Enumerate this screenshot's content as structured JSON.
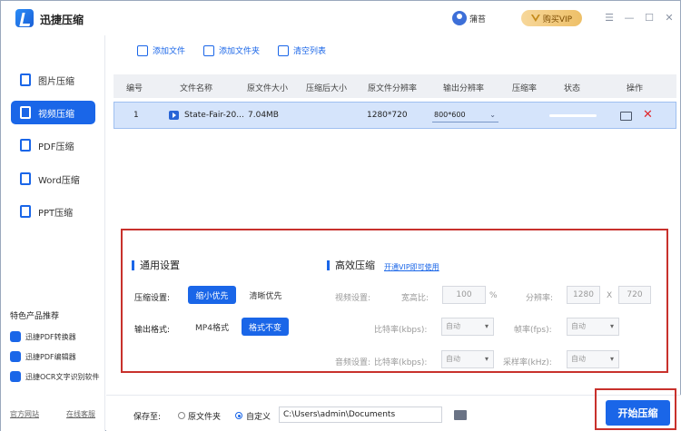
{
  "app": {
    "title": "迅捷压缩",
    "user": "蒲苔",
    "vip_label": "购买VIP"
  },
  "sidebar": {
    "items": [
      {
        "label": "图片压缩",
        "icon": "image-icon"
      },
      {
        "label": "视频压缩",
        "icon": "video-icon",
        "active": true
      },
      {
        "label": "PDF压缩",
        "icon": "pdf-icon"
      },
      {
        "label": "Word压缩",
        "icon": "word-icon"
      },
      {
        "label": "PPT压缩",
        "icon": "ppt-icon"
      }
    ],
    "promo_title": "特色产品推荐",
    "promo": [
      "迅捷PDF转换器",
      "迅捷PDF编辑器",
      "迅捷OCR文字识别软件"
    ],
    "footer_left": "官方网站",
    "footer_right": "在线客服"
  },
  "toolbar": {
    "add_file": "添加文件",
    "add_folder": "添加文件夹",
    "clear_list": "清空列表"
  },
  "table": {
    "headers": [
      "编号",
      "文件名称",
      "原文件大小",
      "压缩后大小",
      "原文件分辨率",
      "输出分辨率",
      "压缩率",
      "状态",
      "操作"
    ],
    "rows": [
      {
        "index": "1",
        "name": "State-Fair-20...",
        "size": "7.04MB",
        "compressed": "",
        "resolution": "1280*720",
        "output_res": "800*600",
        "ratio": "",
        "status_progress": 0
      }
    ]
  },
  "general": {
    "title": "通用设置",
    "compress_label": "压缩设置:",
    "compress_options": [
      "缩小优先",
      "清晰优先"
    ],
    "output_label": "输出格式:",
    "output_format": "MP4格式",
    "keep_format": "格式不变"
  },
  "efficient": {
    "title": "高效压缩",
    "vip_link": "开通VIP即可使用",
    "video_label": "视频设置:",
    "aspect_label": "宽高比:",
    "aspect_value": "100",
    "aspect_unit": "%",
    "resolution_label": "分辨率:",
    "res_w": "1280",
    "res_x": "X",
    "res_h": "720",
    "bitrate_label": "比特率(kbps):",
    "auto": "自动",
    "framerate_label": "帧率(fps):",
    "audio_label": "音频设置:",
    "audio_bitrate_label": "比特率(kbps):",
    "samplerate_label": "采样率(kHz):"
  },
  "bottom": {
    "save_label": "保存至:",
    "opt_original": "原文件夹",
    "opt_custom": "自定义",
    "path": "C:\\Users\\admin\\Documents",
    "start": "开始压缩"
  }
}
